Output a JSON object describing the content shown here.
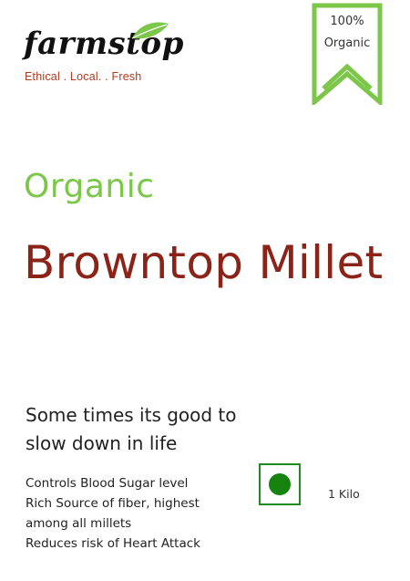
{
  "brand": {
    "name": "farmstop",
    "tagline": "Ethical . Local. . Fresh"
  },
  "badge": {
    "line1": "100%",
    "line2": "Organic",
    "color": "#7cc64a"
  },
  "product": {
    "qualifier": "Organic",
    "name": "Browntop Millet"
  },
  "slogan": "Some times its good to slow down in life",
  "benefits": [
    "Controls Blood Sugar level",
    "Rich Source of fiber, highest among all millets",
    "Reduces risk of Heart Attack"
  ],
  "veg_mark": {
    "icon": "veg-symbol-icon",
    "color": "#16830f"
  },
  "weight": "1 Kilo",
  "colors": {
    "accent_green": "#7cc64a",
    "title_red": "#8c2318",
    "tagline_red": "#b23a1e"
  }
}
